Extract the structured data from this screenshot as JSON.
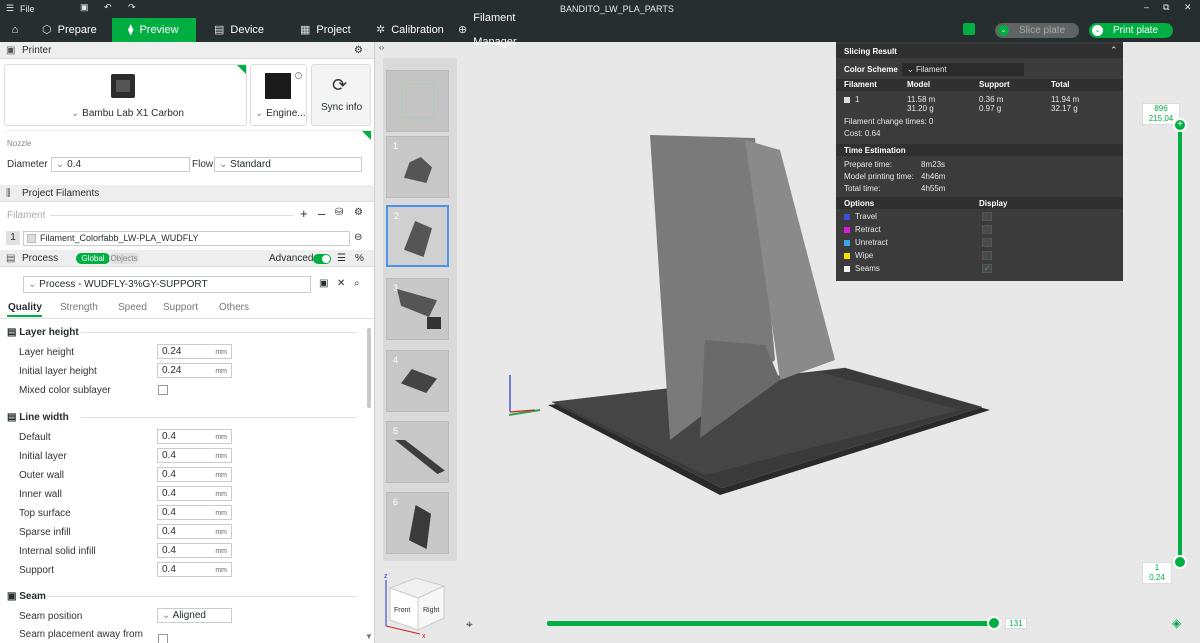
{
  "window": {
    "title": "BANDITO_LW_PLA_PARTS",
    "file_menu": "File"
  },
  "tabs": {
    "prepare": "Prepare",
    "preview": "Preview",
    "device": "Device",
    "project": "Project",
    "calibration": "Calibration",
    "filament_manager": "Filament Manager"
  },
  "actions": {
    "slice_plate": "Slice plate",
    "print_plate": "Print plate"
  },
  "printer": {
    "header": "Printer",
    "model": "Bambu Lab X1 Carbon",
    "plate": "Engine...",
    "sync": "Sync info",
    "nozzle_label": "Nozzle",
    "diameter_label": "Diameter",
    "diameter_value": "0.4",
    "flow_label": "Flow",
    "flow_value": "Standard"
  },
  "filaments": {
    "header": "Project Filaments",
    "label": "Filament",
    "index": "1",
    "name": "Filament_Colorfabb_LW-PLA_WUDFLY"
  },
  "process": {
    "header": "Process",
    "global": "Global",
    "objects": "Objects",
    "advanced": "Advanced",
    "preset": "Process - WUDFLY-3%GY-SUPPORT",
    "subtabs": [
      "Quality",
      "Strength",
      "Speed",
      "Support",
      "Others"
    ],
    "layer_height_group": "Layer height",
    "layer_height": {
      "label": "Layer height",
      "value": "0.24",
      "unit": "mm"
    },
    "initial_layer_height": {
      "label": "Initial layer height",
      "value": "0.24",
      "unit": "mm"
    },
    "mixed_color": "Mixed color sublayer",
    "line_width_group": "Line width",
    "line_widths": [
      {
        "label": "Default",
        "value": "0.4",
        "unit": "mm"
      },
      {
        "label": "Initial layer",
        "value": "0.4",
        "unit": "mm"
      },
      {
        "label": "Outer wall",
        "value": "0.4",
        "unit": "mm"
      },
      {
        "label": "Inner wall",
        "value": "0.4",
        "unit": "mm"
      },
      {
        "label": "Top surface",
        "value": "0.4",
        "unit": "mm"
      },
      {
        "label": "Sparse infill",
        "value": "0.4",
        "unit": "mm"
      },
      {
        "label": "Internal solid infill",
        "value": "0.4",
        "unit": "mm"
      },
      {
        "label": "Support",
        "value": "0.4",
        "unit": "mm"
      }
    ],
    "seam_group": "Seam",
    "seam_position_label": "Seam position",
    "seam_position_value": "Aligned",
    "seam_away_label": "Seam placement away from"
  },
  "plates": [
    "1",
    "2",
    "3",
    "4",
    "5",
    "6"
  ],
  "slicing": {
    "title": "Slicing Result",
    "color_scheme_label": "Color Scheme",
    "color_scheme_value": "Filament",
    "col_filament": "Filament",
    "col_model": "Model",
    "col_support": "Support",
    "col_total": "Total",
    "row_index": "1",
    "model_len": "11.58 m",
    "model_wt": "31.20 g",
    "support_len": "0.36 m",
    "support_wt": "0.97 g",
    "total_len": "11.94 m",
    "total_wt": "32.17 g",
    "change_times": "Filament change times:  0",
    "cost": "Cost:  0.64",
    "time_title": "Time Estimation",
    "prepare_label": "Prepare time:",
    "prepare_value": "8m23s",
    "model_time_label": "Model printing time:",
    "model_time_value": "4h46m",
    "total_time_label": "Total time:",
    "total_time_value": "4h55m",
    "options_label": "Options",
    "display_label": "Display",
    "options": [
      {
        "name": "Travel",
        "color": "#3b4fd8",
        "checked": false
      },
      {
        "name": "Retract",
        "color": "#d81bd8",
        "checked": false
      },
      {
        "name": "Unretract",
        "color": "#3ba6e0",
        "checked": false
      },
      {
        "name": "Wipe",
        "color": "#f5e000",
        "checked": false
      },
      {
        "name": "Seams",
        "color": "#f0f0f0",
        "checked": true
      }
    ]
  },
  "layer_slider": {
    "top_layer": "896",
    "top_height": "215.04",
    "bottom_layer": "1",
    "bottom_height": "0.24"
  },
  "move_slider": {
    "value": "131"
  },
  "view_cube": {
    "front": "Front",
    "right": "Right",
    "axis_z": "z",
    "axis_x": "x"
  },
  "colors": {
    "accent": "#00ae42",
    "dark": "#262e30"
  }
}
